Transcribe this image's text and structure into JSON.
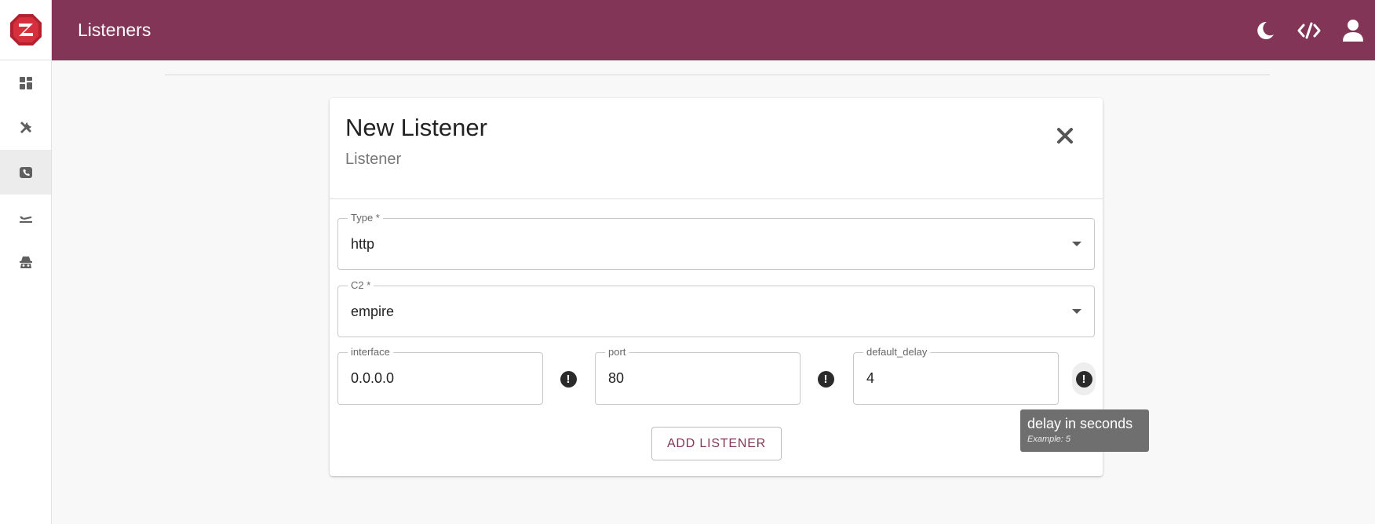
{
  "header": {
    "title": "Listeners"
  },
  "sidebar": {
    "items": [
      {
        "icon": "dashboard-icon",
        "active": false
      },
      {
        "icon": "tools-icon",
        "active": false
      },
      {
        "icon": "phone-icon",
        "active": true
      },
      {
        "icon": "plane-icon",
        "active": false
      },
      {
        "icon": "incognito-icon",
        "active": false
      }
    ]
  },
  "topbar_actions": [
    "dark-mode-icon",
    "code-icon",
    "user-icon"
  ],
  "card": {
    "title": "New Listener",
    "subtitle": "Listener",
    "fields": {
      "type": {
        "label": "Type *",
        "value": "http"
      },
      "c2": {
        "label": "C2 *",
        "value": "empire"
      },
      "interface": {
        "label": "interface",
        "value": "0.0.0.0"
      },
      "port": {
        "label": "port",
        "value": "80"
      },
      "default_delay": {
        "label": "default_delay",
        "value": "4"
      }
    },
    "submit_label": "ADD LISTENER"
  },
  "tooltip": {
    "text": "delay in seconds",
    "example": "Example: 5"
  },
  "colors": {
    "brand": "#823556",
    "background": "#f8f8f8"
  }
}
